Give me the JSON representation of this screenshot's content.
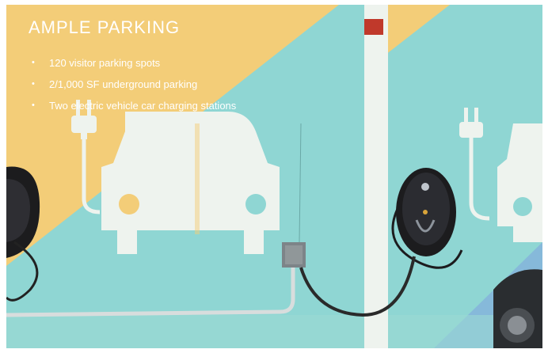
{
  "slide": {
    "title": "AMPLE PARKING",
    "bullets": [
      "120 visitor parking spots",
      "2/1,000 SF underground parking",
      "Two electric vehicle car charging stations"
    ]
  },
  "photo": {
    "description_icons": [
      "ev-charger-icon",
      "car-icon",
      "plug-icon"
    ],
    "colors": {
      "wall_teal": "#8fd6d3",
      "wall_yellow": "#f3cd78",
      "floor_blue": "#86b9da",
      "paint_white": "#eef3ee",
      "charger_black": "#1c1c1e"
    }
  }
}
